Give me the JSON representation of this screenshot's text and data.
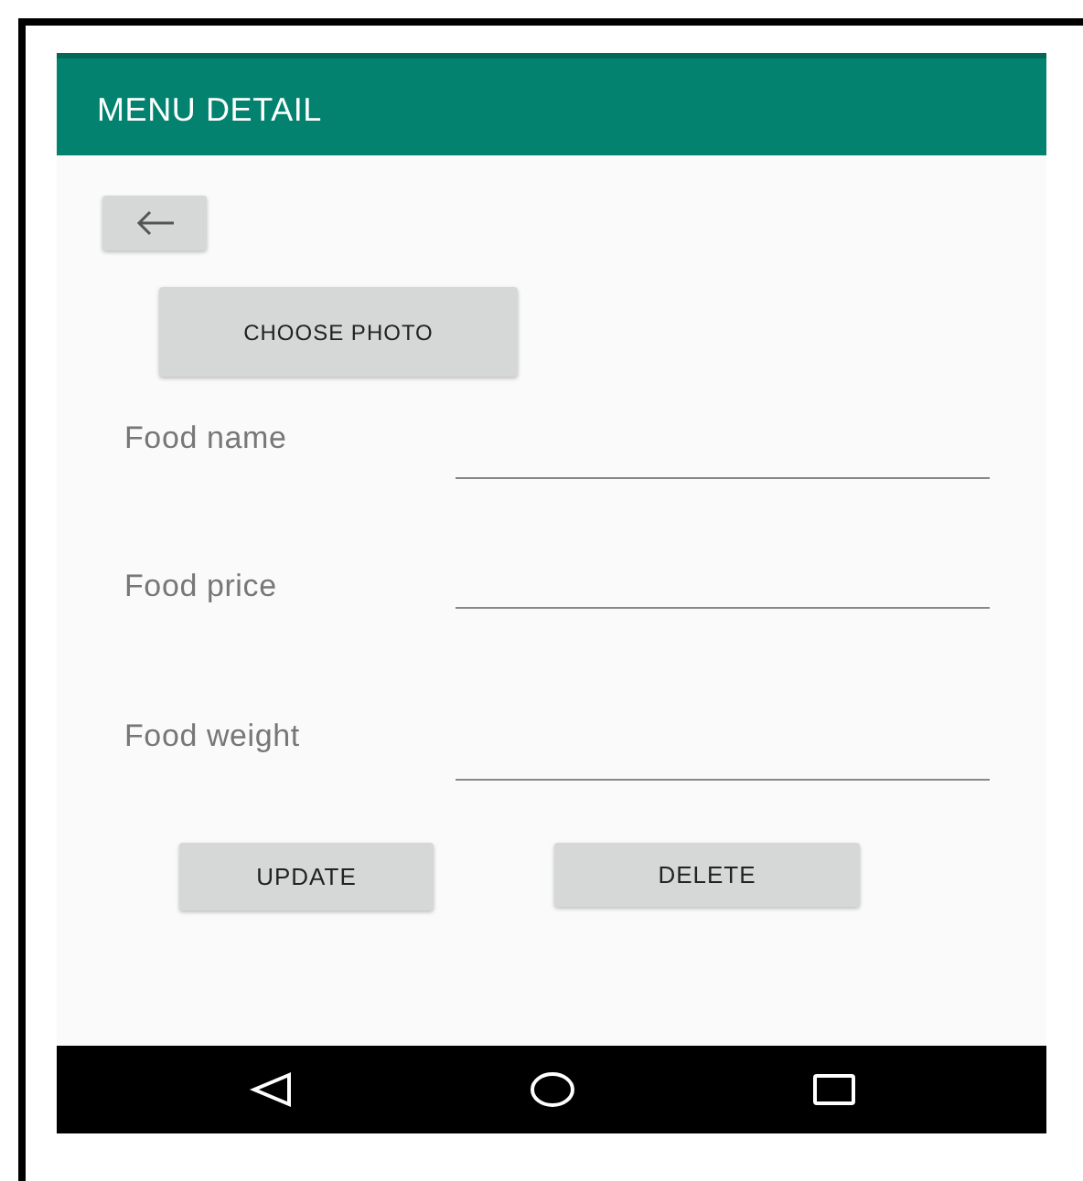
{
  "app_bar": {
    "title": "MENU DETAIL"
  },
  "choose_photo_button": {
    "label": "CHOOSE PHOTO"
  },
  "fields": [
    {
      "label": "Food name"
    },
    {
      "label": "Food price"
    },
    {
      "label": "Food weight"
    }
  ],
  "actions": [
    {
      "label": "UPDATE"
    },
    {
      "label": "DELETE"
    }
  ]
}
